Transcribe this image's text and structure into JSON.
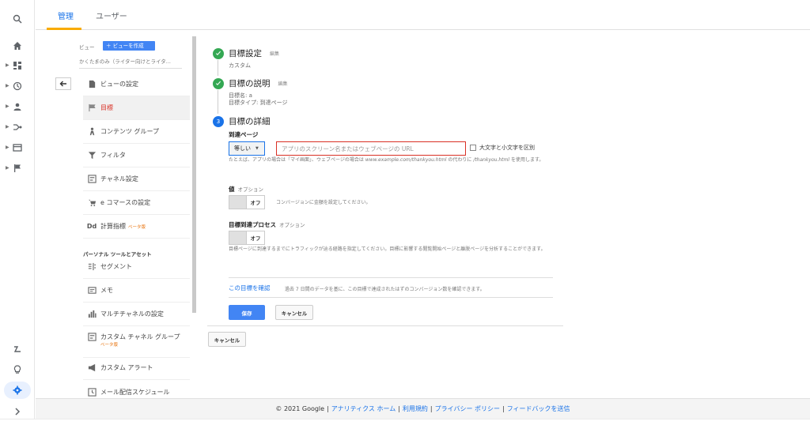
{
  "tabs": {
    "admin": "管理",
    "user": "ユーザー"
  },
  "view": {
    "label": "ビュー",
    "create_button": "＋ ビューを作成",
    "name": "かくたまのみ（ライター向けとライタ..."
  },
  "view_menu": [
    {
      "label": "ビューの設定",
      "icon": "document-icon"
    },
    {
      "label": "目標",
      "icon": "flag-icon",
      "selected": true
    },
    {
      "label": "コンテンツ グループ",
      "icon": "person-group-icon"
    },
    {
      "label": "フィルタ",
      "icon": "filter-icon"
    },
    {
      "label": "チャネル設定",
      "icon": "channel-icon"
    },
    {
      "label": "e コマースの設定",
      "icon": "cart-icon"
    },
    {
      "label": "計算指標",
      "icon": "dd-icon",
      "beta": "ベータ版"
    }
  ],
  "personal_section": {
    "title": "パーソナル ツールとアセット",
    "items": [
      {
        "label": "セグメント",
        "icon": "segment-icon"
      },
      {
        "label": "メモ",
        "icon": "note-icon"
      },
      {
        "label": "マルチチャネルの設定",
        "icon": "bar-chart-icon"
      },
      {
        "label": "カスタム チャネル グループ",
        "icon": "channel-group-icon",
        "beta": "ベータ版"
      },
      {
        "label": "カスタム アラート",
        "icon": "megaphone-icon"
      },
      {
        "label": "メール配信スケジュール",
        "icon": "clock-icon"
      }
    ]
  },
  "goal": {
    "step1": {
      "title": "目標設定",
      "edit": "編集",
      "value": "カスタム"
    },
    "step2": {
      "title": "目標の説明",
      "edit": "編集",
      "name_line": "目標名: a",
      "type_line": "目標タイプ: 到達ページ"
    },
    "step3": {
      "number": "3",
      "title": "目標の詳細"
    },
    "destination": {
      "label": "到達ページ",
      "match": "等しい",
      "placeholder": "アプリのスクリーン名またはウェブページの URL",
      "case_label": "大文字と小文字を区別",
      "help_prefix": "たとえば、アプリの場合は「マイ画面」、ウェブページの場合は",
      "help_example": "www.example.com/thankyou.html",
      "help_mid": "の代わりに",
      "help_path": "/thankyou.html",
      "help_suffix": "を使用します。"
    },
    "value": {
      "label": "値",
      "optional": "オプション",
      "toggle": "オフ",
      "help": "コンバージョンに金額を設定してください。"
    },
    "funnel": {
      "label": "目標到達プロセス",
      "optional": "オプション",
      "toggle": "オフ",
      "help": "目標ページに到達するまでにトラフィックが辿る経路を指定してください。目標に影響する閲覧開始ページと離脱ページを分析することができます。"
    },
    "verify": {
      "link": "この目標を確認",
      "desc": "過去 7 日間のデータを基に、この目標で達成されたはずのコンバージョン数を確認できます。"
    },
    "save": "保存",
    "cancel": "キャンセル",
    "outer_cancel": "キャンセル"
  },
  "footer": {
    "copyright": "© 2021 Google",
    "links": [
      "アナリティクス ホーム",
      "利用規約",
      "プライバシー ポリシー",
      "フィードバックを送信"
    ]
  },
  "colors": {
    "accent": "#1a73e8",
    "success": "#34a853",
    "error": "#d93025",
    "tab_underline": "#f9ab00"
  }
}
